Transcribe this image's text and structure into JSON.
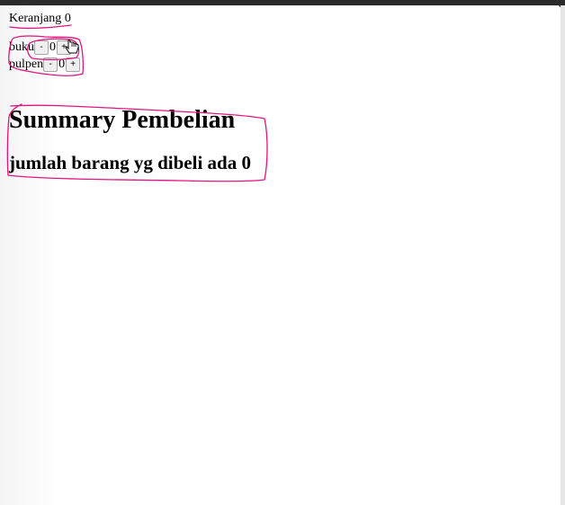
{
  "cart": {
    "label": "Keranjang",
    "count": "0"
  },
  "items": [
    {
      "name": "buku",
      "minus": "-",
      "qty": "0",
      "plus": "+"
    },
    {
      "name": "pulpen",
      "minus": "-",
      "qty": "0",
      "plus": "+"
    }
  ],
  "summary": {
    "title": "Summary Pembelian",
    "text": "jumlah barang yg dibeli ada 0"
  },
  "colors": {
    "annotation": "#e0167f",
    "window_bar": "#2b2b2b"
  },
  "icons": {
    "cursor": "hand-cursor-icon"
  }
}
